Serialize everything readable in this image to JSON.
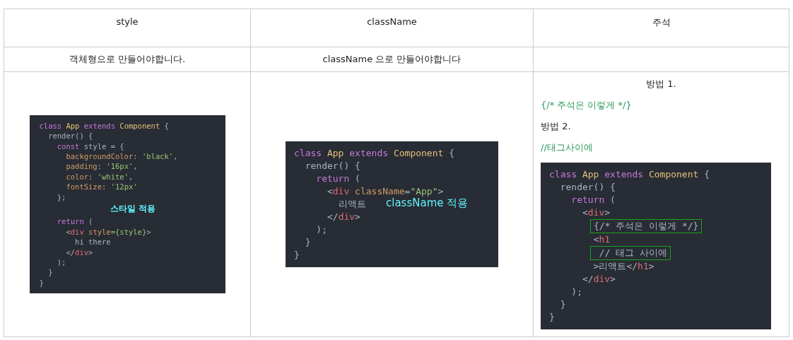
{
  "table": {
    "columns": [
      "style",
      "className",
      "주석"
    ],
    "row_2": [
      "객체형으로 만들어야합니다.",
      "className 으로 만들어야합니다"
    ],
    "row_3": {
      "style_code": {
        "kind": "compact",
        "lines": [
          {
            "kind": "code",
            "tokens": [
              {
                "text": "class ",
                "kind": "keyword"
              },
              {
                "text": "App ",
                "kind": "type"
              },
              {
                "text": "extends ",
                "kind": "keyword"
              },
              {
                "text": "Component ",
                "kind": "type"
              },
              {
                "text": "{",
                "kind": "plain"
              }
            ]
          },
          {
            "kind": "code",
            "tokens": [
              {
                "text": "  render() {",
                "kind": "plain"
              }
            ]
          },
          {
            "kind": "code",
            "tokens": [
              {
                "text": "    const ",
                "kind": "keyword"
              },
              {
                "text": "style = {",
                "kind": "plain"
              }
            ]
          },
          {
            "kind": "code",
            "tokens": [
              {
                "text": "      backgroundColor",
                "kind": "attr"
              },
              {
                "text": ": ",
                "kind": "plain"
              },
              {
                "text": "'black'",
                "kind": "string"
              },
              {
                "text": ",",
                "kind": "plain"
              }
            ]
          },
          {
            "kind": "code",
            "tokens": [
              {
                "text": "      padding",
                "kind": "attr"
              },
              {
                "text": ": ",
                "kind": "plain"
              },
              {
                "text": "'16px'",
                "kind": "string"
              },
              {
                "text": ",",
                "kind": "plain"
              }
            ]
          },
          {
            "kind": "code",
            "tokens": [
              {
                "text": "      color",
                "kind": "attr"
              },
              {
                "text": ": ",
                "kind": "plain"
              },
              {
                "text": "'white'",
                "kind": "string"
              },
              {
                "text": ",",
                "kind": "plain"
              }
            ]
          },
          {
            "kind": "code",
            "tokens": [
              {
                "text": "      fontSize",
                "kind": "attr"
              },
              {
                "text": ": ",
                "kind": "plain"
              },
              {
                "text": "'12px'",
                "kind": "string"
              }
            ]
          },
          {
            "kind": "code",
            "tokens": [
              {
                "text": "    };",
                "kind": "plain"
              }
            ]
          },
          {
            "kind": "note",
            "text": "스타일 적용"
          },
          {
            "kind": "code",
            "tokens": [
              {
                "text": "    return ",
                "kind": "keyword"
              },
              {
                "text": "(",
                "kind": "plain"
              }
            ]
          },
          {
            "kind": "code",
            "tokens": [
              {
                "text": "      <",
                "kind": "plain"
              },
              {
                "text": "div ",
                "kind": "tag"
              },
              {
                "text": "style",
                "kind": "attr"
              },
              {
                "text": "={style}",
                "kind": "string"
              },
              {
                "text": ">",
                "kind": "plain"
              }
            ]
          },
          {
            "kind": "code",
            "tokens": [
              {
                "text": "        hi there",
                "kind": "plain"
              }
            ]
          },
          {
            "kind": "code",
            "tokens": [
              {
                "text": "      </",
                "kind": "plain"
              },
              {
                "text": "div",
                "kind": "tag"
              },
              {
                "text": ">",
                "kind": "plain"
              }
            ]
          },
          {
            "kind": "code",
            "tokens": [
              {
                "text": "    );",
                "kind": "plain"
              }
            ]
          },
          {
            "kind": "code",
            "tokens": [
              {
                "text": "  }",
                "kind": "plain"
              }
            ]
          },
          {
            "kind": "code",
            "tokens": [
              {
                "text": "}",
                "kind": "plain"
              }
            ]
          }
        ]
      },
      "classname_code": {
        "kind": "regular",
        "note": "className 적용",
        "lines": [
          {
            "kind": "code",
            "tokens": [
              {
                "text": "class ",
                "kind": "keyword"
              },
              {
                "text": "App ",
                "kind": "type"
              },
              {
                "text": "extends ",
                "kind": "keyword"
              },
              {
                "text": "Component ",
                "kind": "type"
              },
              {
                "text": "{",
                "kind": "plain"
              }
            ]
          },
          {
            "kind": "code",
            "tokens": [
              {
                "text": "  render() {",
                "kind": "plain"
              }
            ]
          },
          {
            "kind": "code",
            "tokens": [
              {
                "text": "    return ",
                "kind": "keyword"
              },
              {
                "text": "(",
                "kind": "plain"
              }
            ]
          },
          {
            "kind": "code",
            "tokens": [
              {
                "text": "      <",
                "kind": "plain"
              },
              {
                "text": "div ",
                "kind": "tag"
              },
              {
                "text": "className",
                "kind": "attr"
              },
              {
                "text": "=",
                "kind": "plain"
              },
              {
                "text": "\"App\"",
                "kind": "string"
              },
              {
                "text": ">",
                "kind": "plain"
              }
            ]
          },
          {
            "kind": "code",
            "tokens": [
              {
                "text": "        리액트",
                "kind": "plain"
              }
            ]
          },
          {
            "kind": "code",
            "tokens": [
              {
                "text": "      </",
                "kind": "plain"
              },
              {
                "text": "div",
                "kind": "tag"
              },
              {
                "text": ">",
                "kind": "plain"
              }
            ]
          },
          {
            "kind": "code",
            "tokens": [
              {
                "text": "    );",
                "kind": "plain"
              }
            ]
          },
          {
            "kind": "code",
            "tokens": [
              {
                "text": "  }",
                "kind": "plain"
              }
            ]
          },
          {
            "kind": "code",
            "tokens": [
              {
                "text": "}",
                "kind": "plain"
              }
            ]
          }
        ]
      },
      "comment_texts": [
        {
          "kind": "centered",
          "text": "방법 1."
        },
        {
          "kind": "comment",
          "text": "{/*  주석은 이렇게 */}"
        },
        {
          "kind": "plain",
          "text": "방법 2."
        },
        {
          "kind": "comment",
          "text": "//태그사이에"
        }
      ],
      "comment_code": {
        "kind": "regular",
        "lines": [
          {
            "kind": "code",
            "tokens": [
              {
                "text": "class ",
                "kind": "keyword"
              },
              {
                "text": "App ",
                "kind": "type"
              },
              {
                "text": "extends ",
                "kind": "keyword"
              },
              {
                "text": "Component ",
                "kind": "type"
              },
              {
                "text": "{",
                "kind": "plain"
              }
            ]
          },
          {
            "kind": "code",
            "tokens": [
              {
                "text": "  render() {",
                "kind": "plain"
              }
            ]
          },
          {
            "kind": "code",
            "tokens": [
              {
                "text": "    return ",
                "kind": "keyword"
              },
              {
                "text": "(",
                "kind": "plain"
              }
            ]
          },
          {
            "kind": "code",
            "tokens": [
              {
                "text": "      <",
                "kind": "plain"
              },
              {
                "text": "div",
                "kind": "tag"
              },
              {
                "text": ">",
                "kind": "plain"
              }
            ]
          },
          {
            "kind": "boxed",
            "tokens": [
              {
                "text": "{/* 주석은 이렇게 */}",
                "kind": "plain"
              }
            ]
          },
          {
            "kind": "code",
            "tokens": [
              {
                "text": "        <",
                "kind": "plain"
              },
              {
                "text": "h1",
                "kind": "tag"
              }
            ]
          },
          {
            "kind": "boxed",
            "tokens": [
              {
                "text": " // 태그 사이에",
                "kind": "plain"
              }
            ]
          },
          {
            "kind": "code",
            "tokens": [
              {
                "text": "        >리액트</",
                "kind": "plain"
              },
              {
                "text": "h1",
                "kind": "tag"
              },
              {
                "text": ">",
                "kind": "plain"
              }
            ]
          },
          {
            "kind": "code",
            "tokens": [
              {
                "text": "      </",
                "kind": "plain"
              },
              {
                "text": "div",
                "kind": "tag"
              },
              {
                "text": ">",
                "kind": "plain"
              }
            ]
          },
          {
            "kind": "code",
            "tokens": [
              {
                "text": "    );",
                "kind": "plain"
              }
            ]
          },
          {
            "kind": "code",
            "tokens": [
              {
                "text": "  }",
                "kind": "plain"
              }
            ]
          },
          {
            "kind": "code",
            "tokens": [
              {
                "text": "}",
                "kind": "plain"
              }
            ]
          }
        ]
      }
    }
  }
}
